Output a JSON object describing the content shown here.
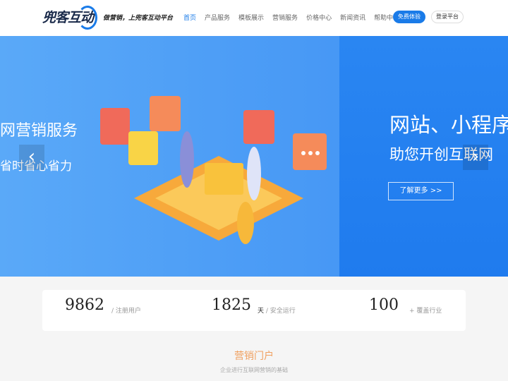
{
  "header": {
    "logo": "兜客互动",
    "slogan": "做营销，上兜客互动平台",
    "nav": [
      "首页",
      "产品服务",
      "模板展示",
      "营销服务",
      "价格中心",
      "新闻资讯",
      "帮助中心"
    ],
    "free_trial": "免费体验",
    "login": "登录平台"
  },
  "banner": {
    "left_title": "网营销服务",
    "left_subtitle": "省时省心省力",
    "right_title": "网站、小程序",
    "right_subtitle": "助您开创互联网",
    "more_button": "了解更多 >>",
    "prev": "‹",
    "next": "›"
  },
  "stats": [
    {
      "value": "9862",
      "unit": "",
      "label": "/ 注册用户"
    },
    {
      "value": "1825",
      "unit": "天",
      "label": "/ 安全运行"
    },
    {
      "value": "100",
      "unit": "",
      "label": "+ 覆盖行业"
    }
  ],
  "section": {
    "title": "营销门户",
    "subtitle": "企业进行互联网营销的基础"
  },
  "colors": {
    "primary": "#1a7be8",
    "accent": "#f0a060"
  }
}
